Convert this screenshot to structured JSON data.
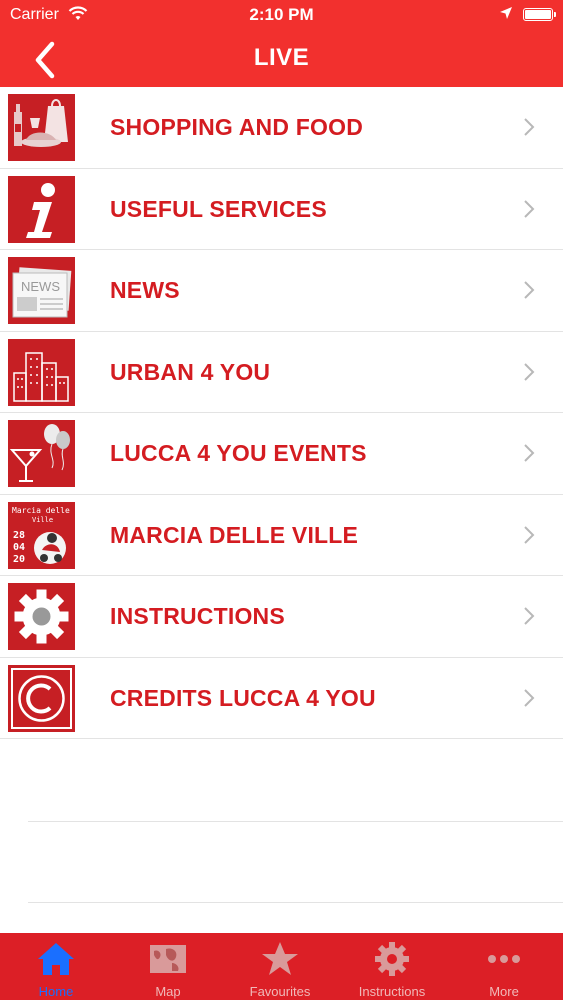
{
  "status_bar": {
    "carrier": "Carrier",
    "time": "2:10 PM"
  },
  "header": {
    "title": "LIVE"
  },
  "menu": [
    {
      "label": "SHOPPING AND FOOD",
      "icon": "shopping-food-icon"
    },
    {
      "label": "USEFUL SERVICES",
      "icon": "info-icon"
    },
    {
      "label": "NEWS",
      "icon": "newspaper-icon",
      "thumb_text": "NEWS"
    },
    {
      "label": "URBAN 4 YOU",
      "icon": "city-buildings-icon"
    },
    {
      "label": "LUCCA 4 YOU EVENTS",
      "icon": "cocktail-balloons-icon"
    },
    {
      "label": "MARCIA DELLE VILLE",
      "icon": "marcia-delle-ville-logo",
      "thumb_title_1": "Marcia delle",
      "thumb_title_2": "Ville",
      "thumb_date": [
        "28",
        "04",
        "20"
      ]
    },
    {
      "label": "INSTRUCTIONS",
      "icon": "gear-icon"
    },
    {
      "label": "CREDITS LUCCA 4 YOU",
      "icon": "copyright-icon"
    }
  ],
  "tabs": [
    {
      "label": "Home",
      "icon": "home-icon",
      "active": true
    },
    {
      "label": "Map",
      "icon": "map-icon",
      "active": false
    },
    {
      "label": "Favourites",
      "icon": "star-icon",
      "active": false
    },
    {
      "label": "Instructions",
      "icon": "gear-icon",
      "active": false
    },
    {
      "label": "More",
      "icon": "more-dots-icon",
      "active": false
    }
  ],
  "colors": {
    "brand_red": "#f2302e",
    "text_red": "#d41c21",
    "tab_bar": "#dc1f26",
    "active_tab": "#1a6fff"
  }
}
